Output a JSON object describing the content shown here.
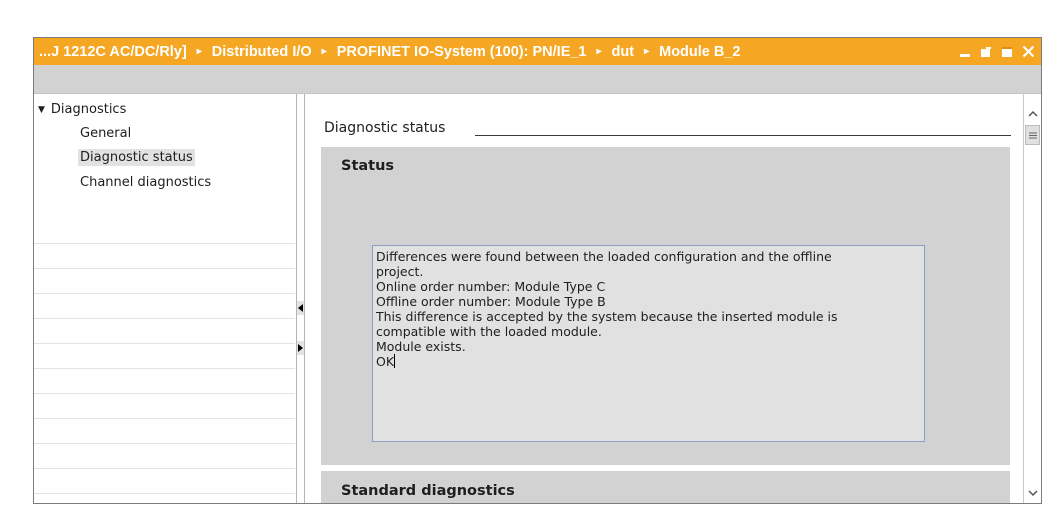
{
  "window": {
    "breadcrumbs": [
      "...J 1212C AC/DC/Rly]",
      "Distributed I/O",
      "PROFINET IO-System (100): PN/IE_1",
      "dut",
      "Module B_2"
    ],
    "breadcrumb_separator": "▸",
    "controls": [
      "minimize-icon",
      "restore-icon",
      "maximize-icon",
      "close-icon"
    ],
    "accent_color": "#f5a623"
  },
  "nav": {
    "group": "Diagnostics",
    "items": [
      "General",
      "Diagnostic status",
      "Channel diagnostics"
    ],
    "selected": "Diagnostic status"
  },
  "content": {
    "section_title": "Diagnostic status",
    "status_panel_title": "Status",
    "status_text": "Differences were found between the loaded configuration and the offline\nproject.\nOnline order number: Module Type C\nOffline order number: Module Type B\nThis difference is accepted by the system because the inserted module is\ncompatible with the loaded module.\nModule exists.\nOK",
    "standard_panel_title": "Standard diagnostics"
  }
}
